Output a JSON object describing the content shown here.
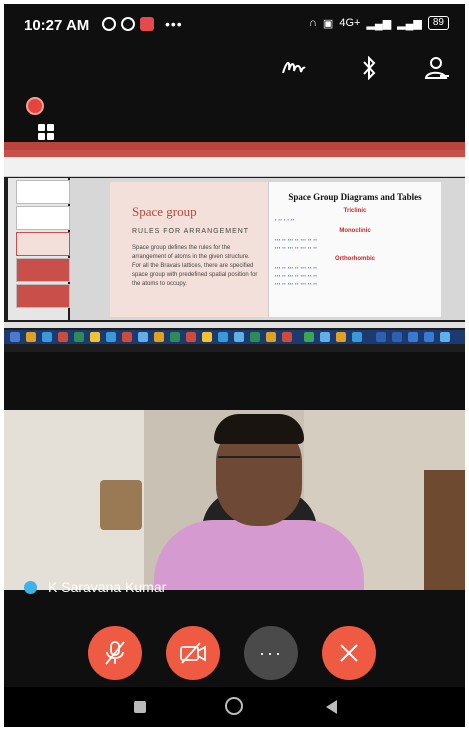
{
  "status_bar": {
    "time": "10:27 AM",
    "network_label": "4G+",
    "battery": "89"
  },
  "slide": {
    "title": "Space group",
    "subtitle": "RULES FOR ARRANGEMENT",
    "body": "Space group defines the rules for the arrangement of atoms in the given structure. For all the Bravais lattices, there are specified space group with predefined spatial position for the atoms to occupy."
  },
  "web_page": {
    "heading": "Space Group Diagrams and Tables",
    "sections": [
      "Triclinic",
      "Monoclinic",
      "Orthorhombic"
    ]
  },
  "participant": {
    "name": "K Saravana Kumar"
  },
  "colors": {
    "control_red": "#ef5a43",
    "control_gray": "#4a4a4a",
    "slide_accent": "#b24a3c"
  }
}
